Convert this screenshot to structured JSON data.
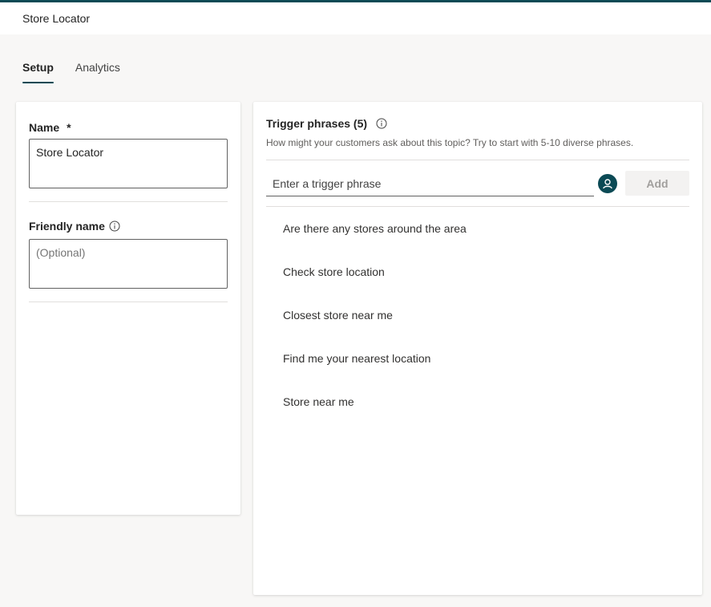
{
  "header": {
    "title": "Store Locator"
  },
  "tabs": [
    {
      "label": "Setup",
      "active": true
    },
    {
      "label": "Analytics",
      "active": false
    }
  ],
  "left_panel": {
    "name_label": "Name",
    "name_required_marker": "*",
    "name_value": "Store Locator",
    "friendly_name_label": "Friendly name",
    "friendly_name_placeholder": "(Optional)"
  },
  "trigger_phrases": {
    "title": "Trigger phrases (5)",
    "description": "How might your customers ask about this topic? Try to start with 5-10 diverse phrases.",
    "input_placeholder": "Enter a trigger phrase",
    "add_label": "Add",
    "items": [
      "Are there any stores around the area",
      "Check store location",
      "Closest store near me",
      "Find me your nearest location",
      "Store near me"
    ]
  },
  "icons": {
    "info": "info-icon",
    "avatar": "person-icon"
  },
  "colors": {
    "accent": "#0b4a55",
    "background": "#f8f7f6",
    "panel": "#ffffff",
    "disabled_text": "#a19f9d"
  }
}
